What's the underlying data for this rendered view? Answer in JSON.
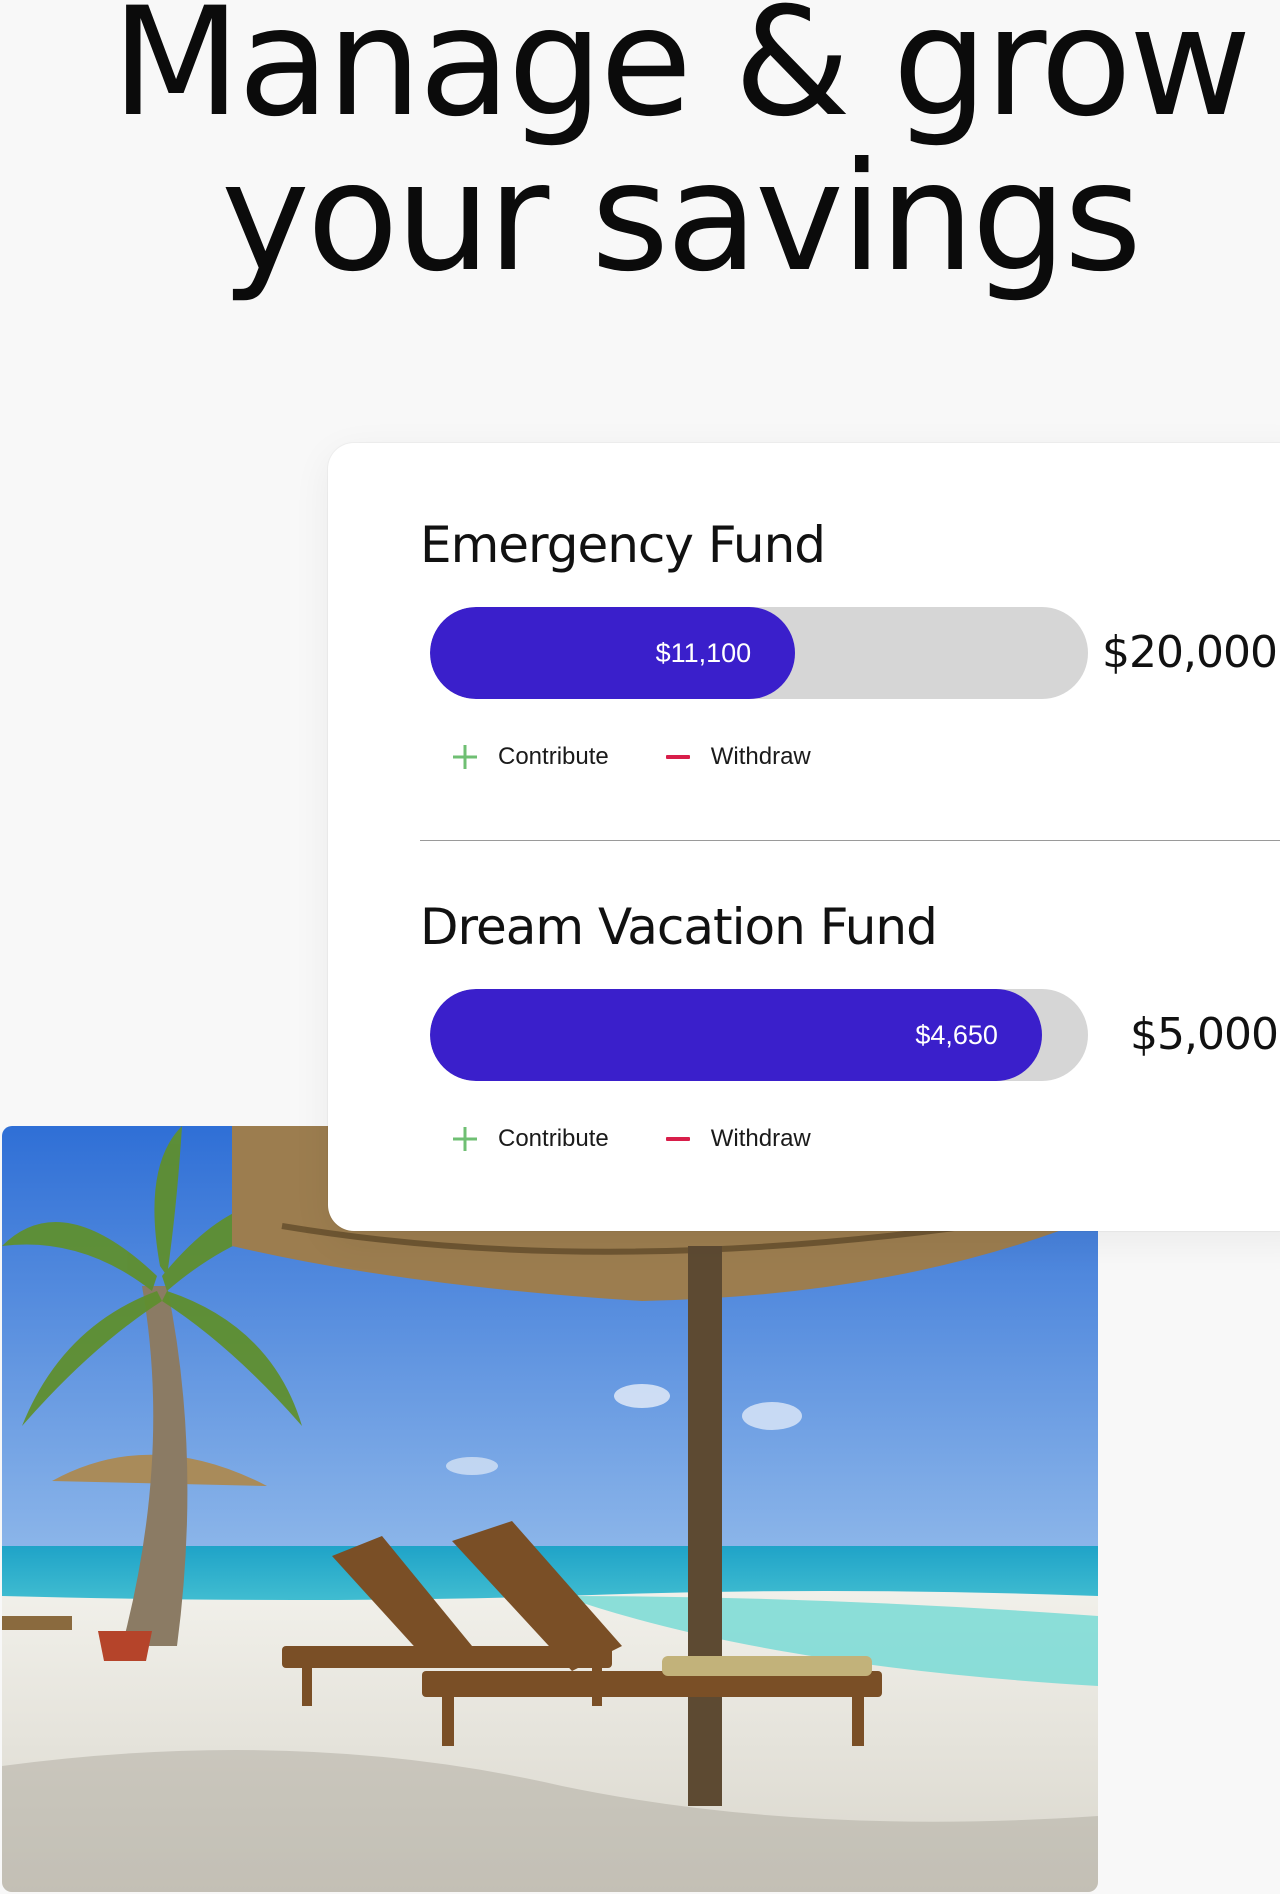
{
  "headline": {
    "line1": "Manage & grow",
    "line2": "your savings"
  },
  "funds": [
    {
      "title": "Emergency Fund",
      "saved_label": "$11,100",
      "goal_label": "$20,000",
      "progress": 0.555,
      "contribute_label": "Contribute",
      "withdraw_label": "Withdraw"
    },
    {
      "title": "Dream Vacation Fund",
      "saved_label": "$4,650",
      "goal_label": "$5,000",
      "progress": 0.93,
      "contribute_label": "Contribute",
      "withdraw_label": "Withdraw"
    }
  ],
  "colors": {
    "progress_fill": "#3a1fcb",
    "progress_track": "#d6d6d6",
    "contribute_icon": "#6fbf73",
    "withdraw_icon": "#d81e4a"
  },
  "icons": {
    "contribute": "plus-icon",
    "withdraw": "minus-icon"
  },
  "photo": {
    "subject": "beach-umbrella-loungers-image"
  }
}
